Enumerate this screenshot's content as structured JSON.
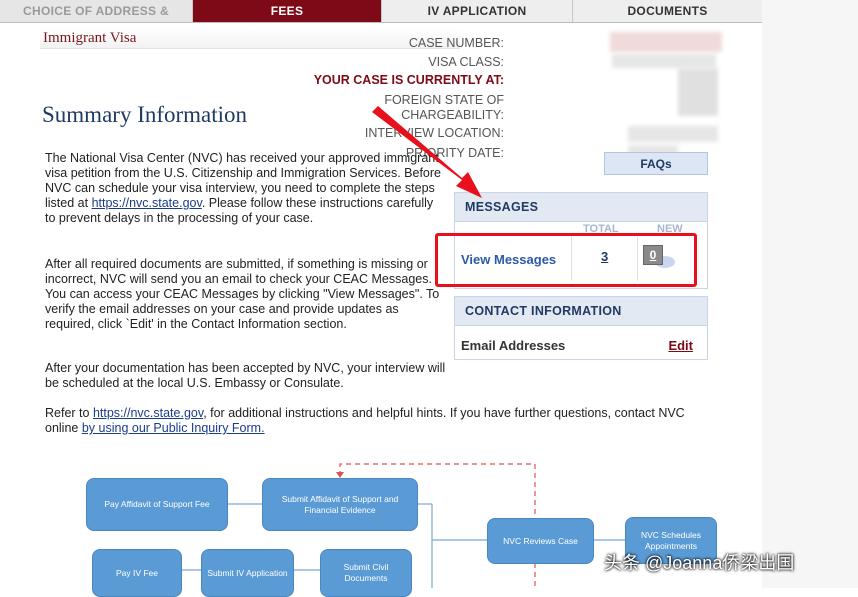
{
  "tabs": [
    "CHOICE OF ADDRESS & AGENT",
    "FEES",
    "IV APPLICATION",
    "DOCUMENTS"
  ],
  "subtitle": "Immigrant Visa",
  "case_info": {
    "case_number_label": "CASE NUMBER:",
    "visa_class_label": "VISA CLASS:",
    "current_status_label": "YOUR CASE IS CURRENTLY AT:",
    "foreign_state_label_line1": "FOREIGN STATE OF",
    "foreign_state_label_line2": "CHARGEABILITY:",
    "interview_location_label": "INTERVIEW LOCATION:",
    "priority_date_label": "PRIORITY DATE:"
  },
  "heading": "Summary Information",
  "paragraphs": {
    "p1_a": "The National Visa Center (NVC) has received your approved immigrant visa petition from the U.S. Citizenship and Immigration Services. Before NVC can schedule your visa interview, you need to complete the steps listed at ",
    "p1_link": "https://nvc.state.gov",
    "p1_b": ". Please follow these instructions carefully to prevent delays in the processing of your case.",
    "p2": "After all required documents are submitted, if something is missing or incorrect, NVC will send you an email to check your CEAC Messages. You can access your CEAC Messages by clicking \"View Messages\". To verify the email addresses on your case and provide updates as required, click `Edit' in the Contact Information section.",
    "p3": "After your documentation has been accepted by NVC, your interview will be scheduled at the local U.S. Embassy or Consulate.",
    "p4_a": "Refer to ",
    "p4_link": "https://nvc.state.gov",
    "p4_b": ", for additional instructions and helpful hints. If you have further questions, contact NVC online ",
    "p4_link2": "by using our Public Inquiry Form."
  },
  "faqs_label": "FAQs",
  "messages": {
    "title": "MESSAGES",
    "col_total": "TOTAL",
    "col_new": "NEW",
    "view_label": "View Messages",
    "total": "3",
    "new": "0"
  },
  "contact": {
    "title": "CONTACT INFORMATION",
    "email_label": "Email Addresses",
    "edit_label": "Edit"
  },
  "flowchart": {
    "nodes": [
      "Pay Affidavit of Support Fee",
      "Submit Affidavit of Support and Financial Evidence",
      "NVC Reviews Case",
      "NVC Schedules Appointments",
      "Pay IV Fee",
      "Submit IV Application",
      "Submit Civil Documents"
    ]
  },
  "watermark": "头条 @Joanna侨梁出国",
  "colors": {
    "active_tab": "#7d0a16",
    "heading": "#1f3a63",
    "panel_header": "#e3e9f3",
    "annotation_red": "#e8101c",
    "flow_node": "#5b9bd5"
  }
}
